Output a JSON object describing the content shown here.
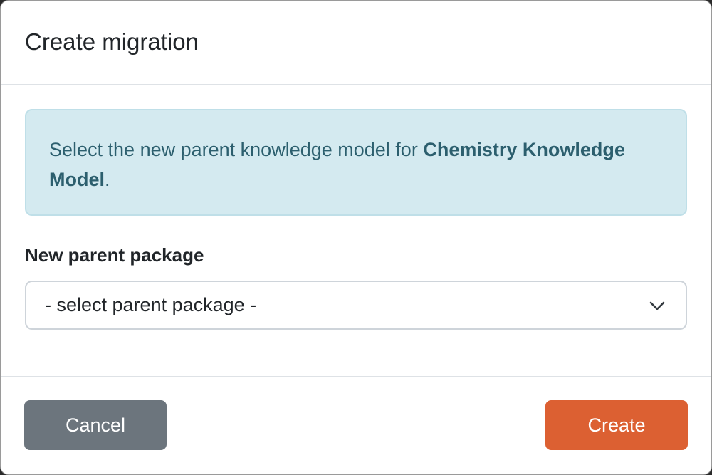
{
  "modal": {
    "title": "Create migration",
    "alert": {
      "prefix": "Select the new parent knowledge model for ",
      "emphasis": "Chemistry Knowledge Model",
      "suffix": "."
    },
    "parent_label": "New parent package",
    "select": {
      "value": "- select parent package -",
      "icon": "chevron-down-icon"
    },
    "buttons": {
      "cancel": "Cancel",
      "create": "Create"
    }
  },
  "colors": {
    "alert_bg": "#d4eaf0",
    "alert_text": "#2c5f6e",
    "cancel_bg": "#6c757d",
    "create_bg": "#dc6032"
  }
}
